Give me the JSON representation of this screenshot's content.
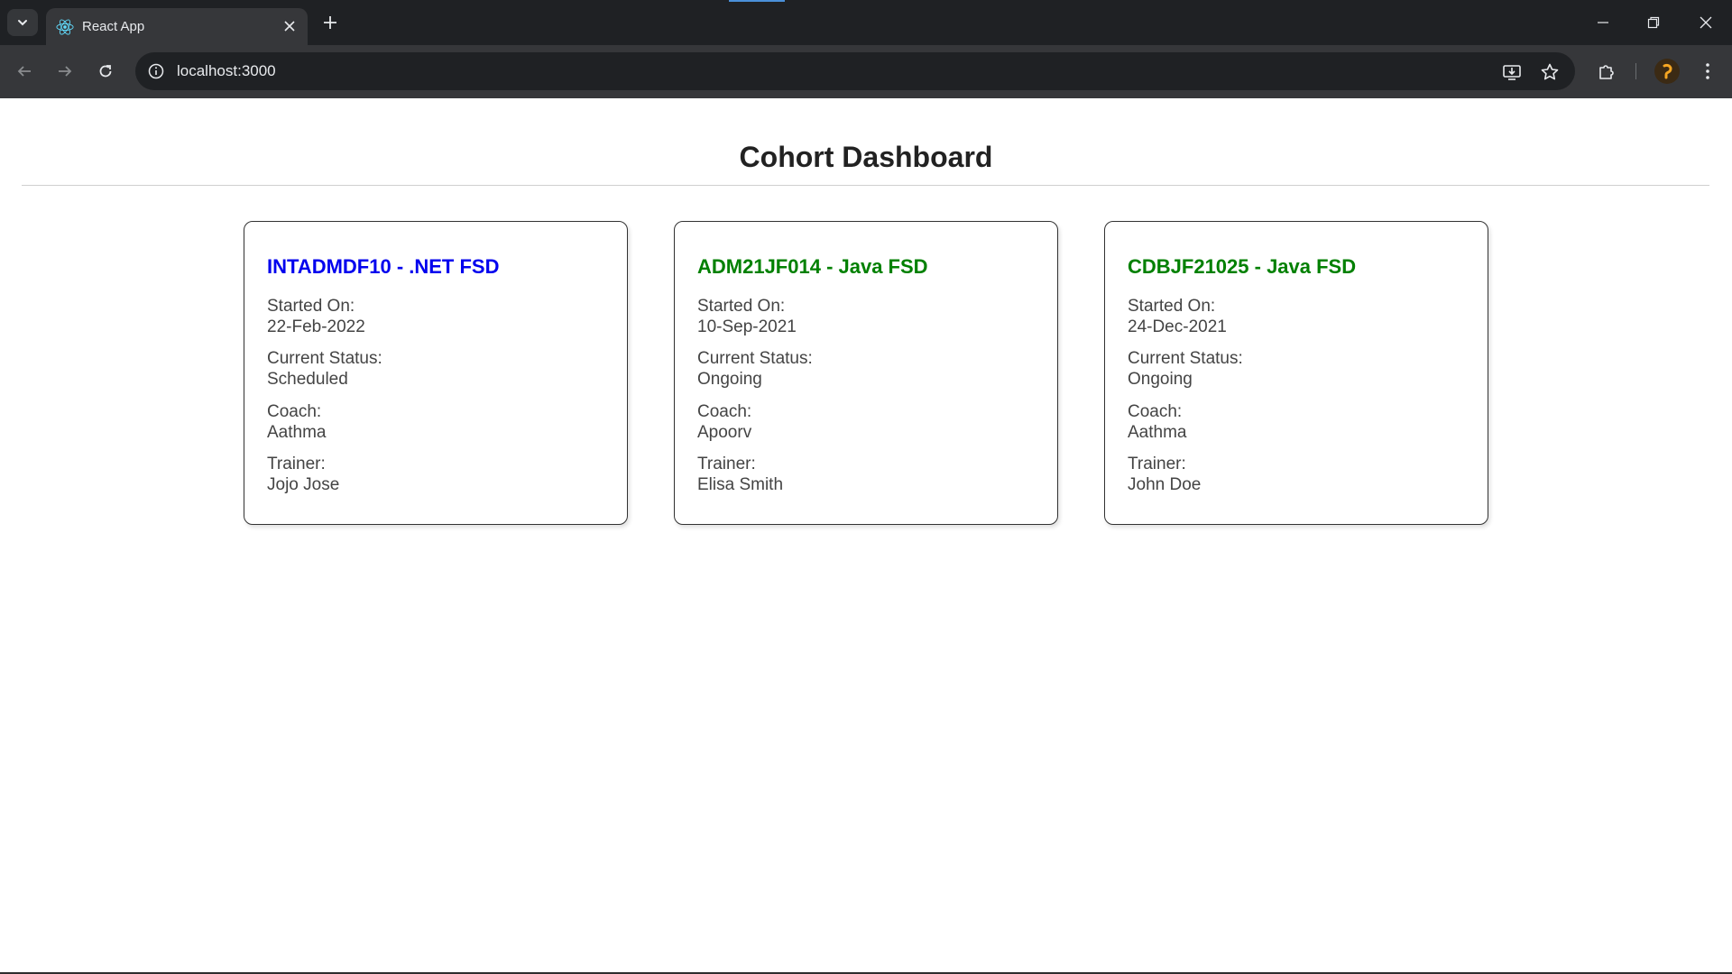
{
  "browser": {
    "tab_title": "React App",
    "url": "localhost:3000"
  },
  "page": {
    "title": "Cohort Dashboard"
  },
  "cohorts": [
    {
      "title": "INTADMDF10 - .NET FSD",
      "title_color": "#0000ee",
      "started_label": "Started On:",
      "started_value": "22-Feb-2022",
      "status_label": "Current Status:",
      "status_value": "Scheduled",
      "coach_label": "Coach:",
      "coach_value": "Aathma",
      "trainer_label": "Trainer:",
      "trainer_value": "Jojo Jose"
    },
    {
      "title": "ADM21JF014 - Java FSD",
      "title_color": "#008000",
      "started_label": "Started On:",
      "started_value": "10-Sep-2021",
      "status_label": "Current Status:",
      "status_value": "Ongoing",
      "coach_label": "Coach:",
      "coach_value": "Apoorv",
      "trainer_label": "Trainer:",
      "trainer_value": "Elisa Smith"
    },
    {
      "title": "CDBJF21025 - Java FSD",
      "title_color": "#008000",
      "started_label": "Started On:",
      "started_value": "24-Dec-2021",
      "status_label": "Current Status:",
      "status_value": "Ongoing",
      "coach_label": "Coach:",
      "coach_value": "Aathma",
      "trainer_label": "Trainer:",
      "trainer_value": "John Doe"
    }
  ],
  "icons": {
    "tab_search": "chevron-down-icon",
    "favicon": "react-icon",
    "tab_close": "close-icon",
    "new_tab": "plus-icon",
    "back": "arrow-left-icon",
    "forward": "arrow-right-icon",
    "reload": "reload-icon",
    "site_info": "info-icon",
    "install": "install-app-icon",
    "bookmark": "star-icon",
    "extensions": "puzzle-icon",
    "menu": "kebab-menu-icon"
  },
  "colors": {
    "chrome_dark": "#1f2124",
    "chrome_toolbar": "#36373a",
    "net_title": "#0000ee",
    "java_title": "#008000"
  }
}
